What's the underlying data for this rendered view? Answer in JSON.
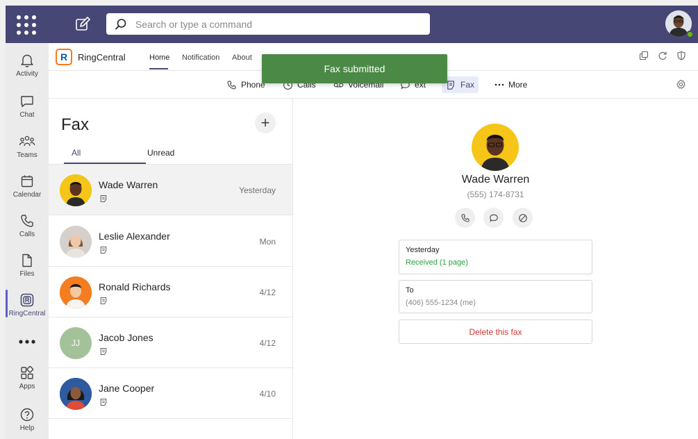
{
  "topbar": {
    "search_placeholder": "Search or type a command"
  },
  "rail": {
    "items": [
      {
        "label": "Activity",
        "icon": "bell-icon"
      },
      {
        "label": "Chat",
        "icon": "chat-icon"
      },
      {
        "label": "Teams",
        "icon": "teams-icon"
      },
      {
        "label": "Calendar",
        "icon": "calendar-icon"
      },
      {
        "label": "Calls",
        "icon": "phone-icon"
      },
      {
        "label": "Files",
        "icon": "file-icon"
      },
      {
        "label": "RingCentral",
        "icon": "ringcentral-icon"
      },
      {
        "label": "Apps",
        "icon": "apps-icon"
      },
      {
        "label": "Help",
        "icon": "help-icon"
      }
    ]
  },
  "app": {
    "name": "RingCentral",
    "tabs": [
      "Home",
      "Notification",
      "About"
    ]
  },
  "toolbar": {
    "items": [
      "Phone",
      "Calls",
      "Voicemail",
      "ext",
      "Fax",
      "More"
    ]
  },
  "toast": {
    "message": "Fax submitted"
  },
  "list": {
    "title": "Fax",
    "add_label": "+",
    "filters": [
      "All",
      "Unread"
    ],
    "rows": [
      {
        "name": "Wade Warren",
        "date": "Yesterday"
      },
      {
        "name": "Leslie Alexander",
        "date": "Mon"
      },
      {
        "name": "Ronald Richards",
        "date": "4/12"
      },
      {
        "name": "Jacob Jones",
        "date": "4/12",
        "initials": "JJ"
      },
      {
        "name": "Jane Cooper",
        "date": "4/10"
      }
    ]
  },
  "detail": {
    "name": "Wade Warren",
    "phone": "(555) 174-8731",
    "received_label": "Yesterday",
    "received_value": "Received (1 page)",
    "to_label": "To",
    "to_value": "(406) 555-1234 (me)",
    "delete_label": "Delete this fax"
  },
  "colors": {
    "topbar": "#464775",
    "accent": "#464775",
    "toast": "#4b8a46",
    "received": "#2f9e44",
    "delete": "#d13438",
    "avatar_yellow": "#f5c518",
    "avatar_orange": "#f57c1f",
    "avatar_green": "#a3c29a",
    "presence": "#6bb700"
  }
}
